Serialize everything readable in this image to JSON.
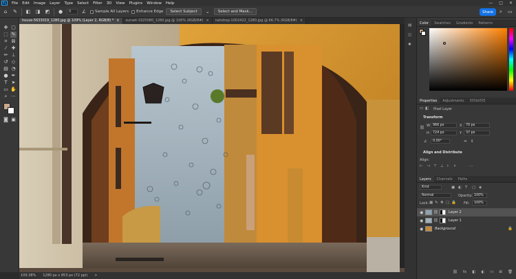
{
  "menu": {
    "app_logo": "Ps",
    "items": [
      "File",
      "Edit",
      "Image",
      "Layer",
      "Type",
      "Select",
      "Filter",
      "3D",
      "View",
      "Plugins",
      "Window",
      "Help"
    ],
    "window_controls": [
      "—",
      "□",
      "✕"
    ]
  },
  "options": {
    "feather_value": "0",
    "sample_all_layers_label": "Sample All Layers",
    "enhance_edge_label": "Enhance Edge",
    "select_subject_label": "Select Subject",
    "select_and_mask_label": "Select and Mask...",
    "share_label": "Share"
  },
  "tabs": [
    {
      "label": "house-5633019_1280.jpg @ 109% (Layer 2, RGB/8) *",
      "close": "×"
    },
    {
      "label": "sunset-3325080_1280.jpg @ 100% (RGB/8#)",
      "close": "×"
    },
    {
      "label": "raindrop-1002422_1280.jpg @ 66.7% (RGB/8#)",
      "close": "×"
    }
  ],
  "status": {
    "zoom": "109.38%",
    "doc_info": "1280 px x 853 px (72 ppi)",
    "arrow": ">"
  },
  "color_panel": {
    "tabs": [
      "Color",
      "Swatches",
      "Gradients",
      "Patterns"
    ],
    "hue_color": "#ff8000"
  },
  "properties": {
    "tabs": [
      "Properties",
      "Adjustments",
      "라이브러리"
    ],
    "layer_type": "Pixel Layer",
    "transform_title": "Transform",
    "w_label": "W",
    "w_value": "966 px",
    "h_label": "H",
    "h_value": "724 px",
    "x_label": "X",
    "x_value": "70 px",
    "y_label": "Y",
    "y_value": "37 px",
    "angle_value": "0.00°",
    "align_title": "Align and Distribute",
    "align_label": "Align:"
  },
  "layers": {
    "tabs": [
      "Layers",
      "Channels",
      "Paths"
    ],
    "filter_kind": "Kind",
    "blend_mode": "Normal",
    "opacity_label": "Opacity:",
    "opacity_value": "100%",
    "lock_label": "Lock:",
    "fill_label": "Fill:",
    "fill_value": "100%",
    "rows": [
      {
        "name": "Layer 2"
      },
      {
        "name": "Layer 1"
      },
      {
        "name": "Background"
      }
    ],
    "footer_icons": [
      "link-icon",
      "fx-icon",
      "mask-icon",
      "adjustment-icon",
      "folder-icon",
      "new-layer-icon",
      "trash-icon"
    ]
  }
}
